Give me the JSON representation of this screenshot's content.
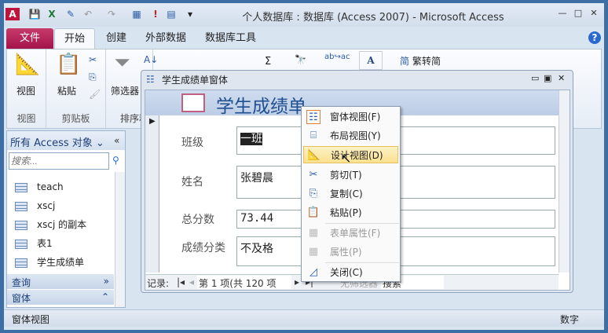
{
  "window": {
    "title": "个人数据库 : 数据库 (Access 2007)  -  Microsoft Access",
    "min": "—",
    "max": "□",
    "close": "✕"
  },
  "quick_access": [
    "A",
    "💾",
    "X",
    "✎",
    "↶",
    "↷",
    "▦",
    "!",
    "▤",
    "▾"
  ],
  "tabs": [
    "文件",
    "开始",
    "创建",
    "外部数据",
    "数据库工具"
  ],
  "ribbon": {
    "groups": [
      {
        "label": "视图",
        "buttons": [
          "视图"
        ]
      },
      {
        "label": "剪贴板",
        "buttons": [
          "粘贴"
        ]
      },
      {
        "label": "排序和筛选",
        "display": "排序和",
        "buttons": [
          "筛选器"
        ]
      }
    ],
    "convert": "繁转简"
  },
  "nav": {
    "header": "所有 Access 对象",
    "search_placeholder": "搜索...",
    "items": [
      "teach",
      "xscj",
      "xscj 的副本",
      "表1",
      "学生成绩单"
    ],
    "groups": [
      "查询",
      "窗体"
    ]
  },
  "form": {
    "window_title": "学生成绩单窗体",
    "header_title": "学生成绩单",
    "fields": [
      {
        "label": "班级",
        "value": "一班"
      },
      {
        "label": "姓名",
        "value": "张碧晨"
      },
      {
        "label": "总分数",
        "value": "73.44"
      },
      {
        "label": "成绩分类",
        "value": "不及格"
      }
    ],
    "record_nav": {
      "label": "记录:",
      "position": "第 1 项(共 120 项",
      "filter": "无筛选器",
      "search": "搜索"
    }
  },
  "context_menu": [
    {
      "label": "窗体视图(F)",
      "icon": "form-view",
      "disabled": false
    },
    {
      "label": "布局视图(Y)",
      "icon": "layout-view",
      "disabled": false
    },
    {
      "label": "设计视图(D)",
      "icon": "design-view",
      "disabled": false,
      "highlighted": true
    },
    {
      "label": "剪切(T)",
      "icon": "scissors",
      "disabled": false
    },
    {
      "label": "复制(C)",
      "icon": "copy",
      "disabled": false
    },
    {
      "label": "粘贴(P)",
      "icon": "paste",
      "disabled": false
    },
    {
      "label": "表单属性(F)",
      "icon": "properties",
      "disabled": true
    },
    {
      "label": "属性(P)",
      "icon": "properties",
      "disabled": true
    },
    {
      "label": "关闭(C)",
      "icon": "close",
      "disabled": false
    }
  ],
  "status": {
    "left": "窗体视图",
    "right": "数字"
  }
}
